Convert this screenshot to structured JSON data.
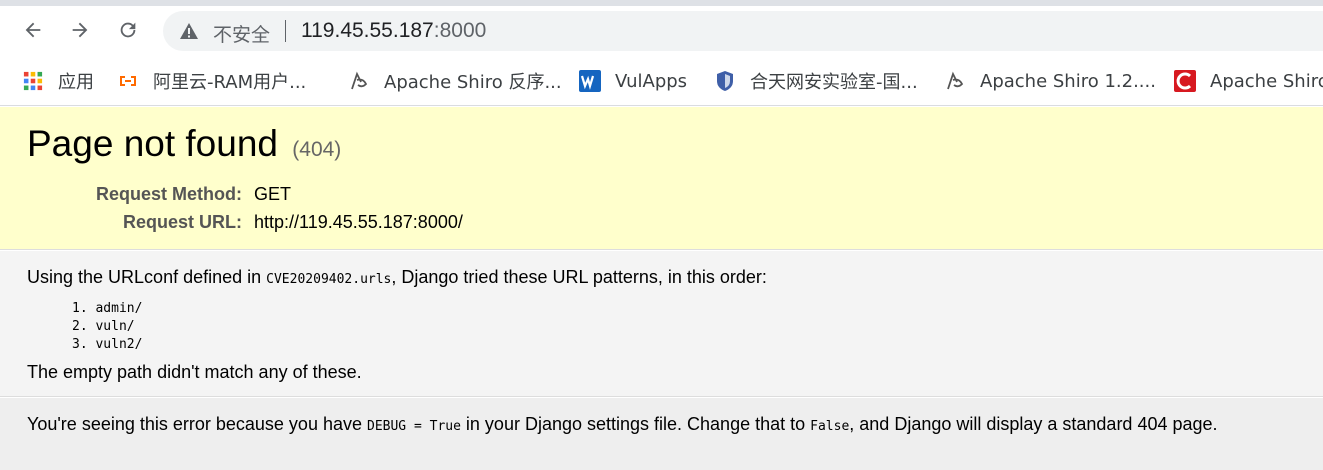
{
  "browser": {
    "address_security": "不安全",
    "url_host": "119.45.55.187",
    "url_port": ":8000"
  },
  "bookmarks": [
    {
      "label": "应用",
      "icon": "apps-grid-icon"
    },
    {
      "label": "阿里云-RAM用户...",
      "icon": "aliyun-icon"
    },
    {
      "label": "Apache Shiro 反序...",
      "icon": "shiro-icon"
    },
    {
      "label": "VulApps",
      "icon": "vulapps-w-icon"
    },
    {
      "label": "合天网安实验室-国...",
      "icon": "hetian-shield-icon"
    },
    {
      "label": "Apache Shiro 1.2....",
      "icon": "shiro-icon"
    },
    {
      "label": "Apache Shiro",
      "icon": "c-red-icon"
    }
  ],
  "summary": {
    "title": "Page not found",
    "code": "(404)",
    "method_label": "Request Method:",
    "method_value": "GET",
    "url_label": "Request URL:",
    "url_value": "http://119.45.55.187:8000/"
  },
  "info": {
    "intro_pre": "Using the URLconf defined in ",
    "urlconf": "CVE20209402.urls",
    "intro_post": ", Django tried these URL patterns, in this order:",
    "patterns": [
      "1. admin/",
      "2. vuln/",
      "3. vuln2/"
    ],
    "nomatch": "The empty path didn't match any of these."
  },
  "explain": {
    "pre": "You're seeing this error because you have ",
    "debug": "DEBUG = True",
    "mid": " in your Django settings file. Change that to ",
    "false": "False",
    "post": ", and Django will display a standard 404 page."
  }
}
